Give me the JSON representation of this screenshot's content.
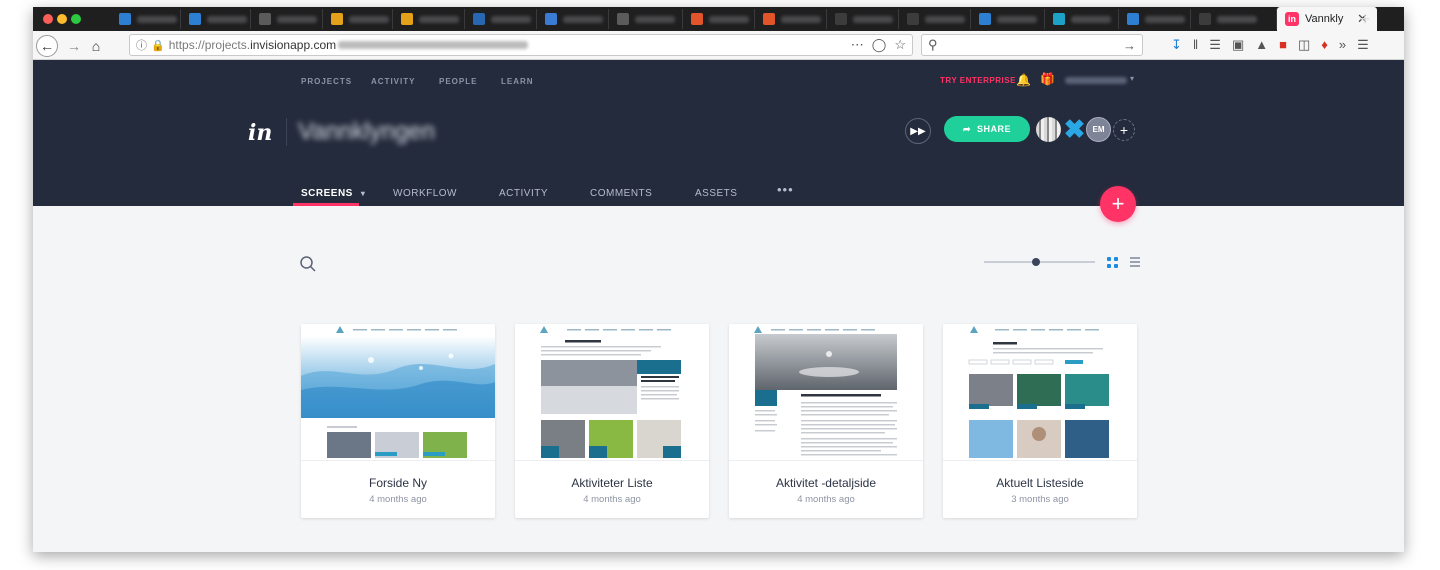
{
  "browser": {
    "active_tab_title": "Vannkly",
    "url_prefix": "https://projects.",
    "url_domain": "invisionapp.com",
    "new_tab_label": "+",
    "close_tab_label": "✕"
  },
  "topnav": {
    "items": [
      "PROJECTS",
      "ACTIVITY",
      "PEOPLE",
      "LEARN"
    ],
    "try_enterprise": "TRY ENTERPRISE"
  },
  "project": {
    "logo": "in",
    "name": "Vannklyngen"
  },
  "actions": {
    "share_label": "SHARE",
    "avatar_initials": "EM",
    "add_label": "+"
  },
  "subnav": {
    "items": [
      "SCREENS",
      "WORKFLOW",
      "ACTIVITY",
      "COMMENTS",
      "ASSETS"
    ],
    "more": "•••",
    "active": "SCREENS"
  },
  "fab_label": "+",
  "screens": [
    {
      "title": "Forside Ny",
      "date": "4 months ago"
    },
    {
      "title": "Aktiviteter Liste",
      "date": "4 months ago"
    },
    {
      "title": "Aktivitet -detaljside",
      "date": "4 months ago"
    },
    {
      "title": "Aktuelt Listeside",
      "date": "3 months ago"
    }
  ],
  "colors": {
    "header_bg": "#242b3c",
    "accent_pink": "#ff3366",
    "share_green": "#1fd09a",
    "grid_blue": "#1d8ce0"
  }
}
